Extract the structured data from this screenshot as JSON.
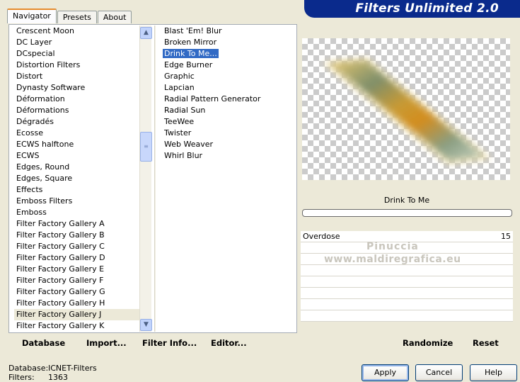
{
  "tabs": [
    "Navigator",
    "Presets",
    "About"
  ],
  "active_tab": "Navigator",
  "banner_title": "Filters Unlimited 2.0",
  "categories": [
    "Crescent Moon",
    "DC Layer",
    "DCspecial",
    "Distortion Filters",
    "Distort",
    "Dynasty Software",
    "Déformation",
    "Déformations",
    "Dégradés",
    "Ecosse",
    "ECWS halftone",
    "ECWS",
    "Edges, Round",
    "Edges, Square",
    "Effects",
    "Emboss Filters",
    "Emboss",
    "Filter Factory Gallery A",
    "Filter Factory Gallery B",
    "Filter Factory Gallery C",
    "Filter Factory Gallery D",
    "Filter Factory Gallery E",
    "Filter Factory Gallery F",
    "Filter Factory Gallery G",
    "Filter Factory Gallery H",
    "Filter Factory Gallery J",
    "Filter Factory Gallery K"
  ],
  "selected_category": "Filter Factory Gallery J",
  "filters": [
    "Blast 'Em! Blur",
    "Broken Mirror",
    "Drink To Me...",
    "Edge Burner",
    "Graphic",
    "Lapcian",
    "Radial Pattern Generator",
    "Radial Sun",
    "TeeWee",
    "Twister",
    "Web Weaver",
    "Whirl Blur"
  ],
  "selected_filter": "Drink To Me...",
  "bottom_buttons": {
    "database": "Database",
    "import": "Import...",
    "filter_info": "Filter Info...",
    "editor": "Editor..."
  },
  "preview_filter_name": "Drink To Me",
  "params": [
    {
      "label": "Overdose",
      "value": "15"
    }
  ],
  "watermark": {
    "line1": "Pinuccia",
    "line2": "www.maldiregrafica.eu"
  },
  "right_buttons": {
    "randomize": "Randomize",
    "reset": "Reset"
  },
  "status": {
    "database_label": "Database:",
    "database_value": "ICNET-Filters",
    "filters_label": "Filters:",
    "filters_value": "1363"
  },
  "dialog_buttons": {
    "apply": "Apply",
    "cancel": "Cancel",
    "help": "Help"
  },
  "colors": {
    "banner": "#0a2a8c",
    "selection": "#316ac5",
    "tab_accent": "#e68b2c"
  }
}
